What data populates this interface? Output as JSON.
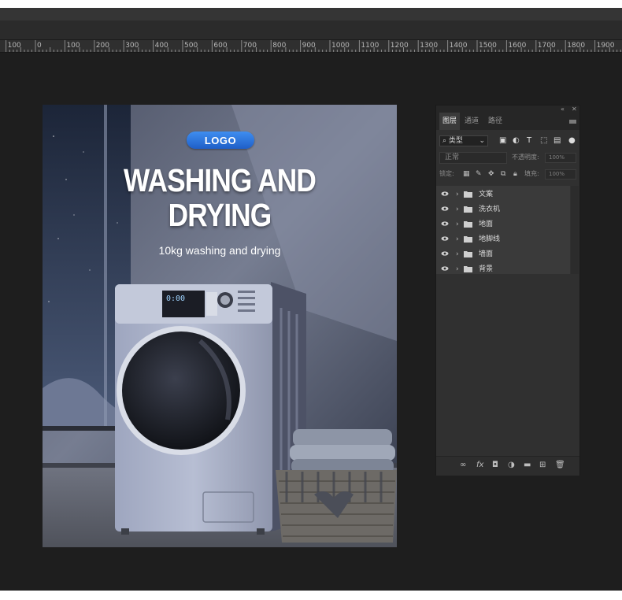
{
  "ruler": {
    "labels": [
      "100",
      "0",
      "100",
      "200",
      "300",
      "400",
      "500",
      "600",
      "700",
      "800",
      "900",
      "1000",
      "1100",
      "1200",
      "1300",
      "1400",
      "1500",
      "1600",
      "1700",
      "1800",
      "1900"
    ]
  },
  "artboard": {
    "logo_text": "LOGO",
    "headline_line1": "WASHING AND",
    "headline_line2": "DRYING",
    "subline": "10kg washing and drying",
    "display_text": "0:00"
  },
  "layers_panel": {
    "tabs": [
      "图层",
      "通道",
      "路径"
    ],
    "active_tab": "图层",
    "filter_label": "类型",
    "blend_mode": "正常",
    "opacity_label": "不透明度:",
    "opacity_value": "100%",
    "lock_label": "锁定:",
    "fill_label": "填充:",
    "fill_value": "100%",
    "layers": [
      {
        "name": "文案"
      },
      {
        "name": "洗衣机"
      },
      {
        "name": "地面"
      },
      {
        "name": "地脚线"
      },
      {
        "name": "墙面"
      },
      {
        "name": "背景"
      }
    ],
    "icons": {
      "filter": [
        "image-filter-icon",
        "adjustment-filter-icon",
        "type-filter-icon",
        "shape-filter-icon",
        "smart-object-filter-icon",
        "filter-toggle-icon"
      ],
      "lock": [
        "lock-pixels-icon",
        "lock-paint-icon",
        "lock-position-icon",
        "lock-artboard-icon",
        "lock-all-icon"
      ],
      "bottom": [
        "link-layers-icon",
        "fx-icon",
        "add-mask-icon",
        "adjustment-layer-icon",
        "new-group-icon",
        "new-layer-icon",
        "delete-layer-icon"
      ]
    }
  },
  "colors": {
    "workspace_bg": "#1e1e1e",
    "panel_bg": "#303030",
    "accent_blue": "#2f7be0"
  }
}
